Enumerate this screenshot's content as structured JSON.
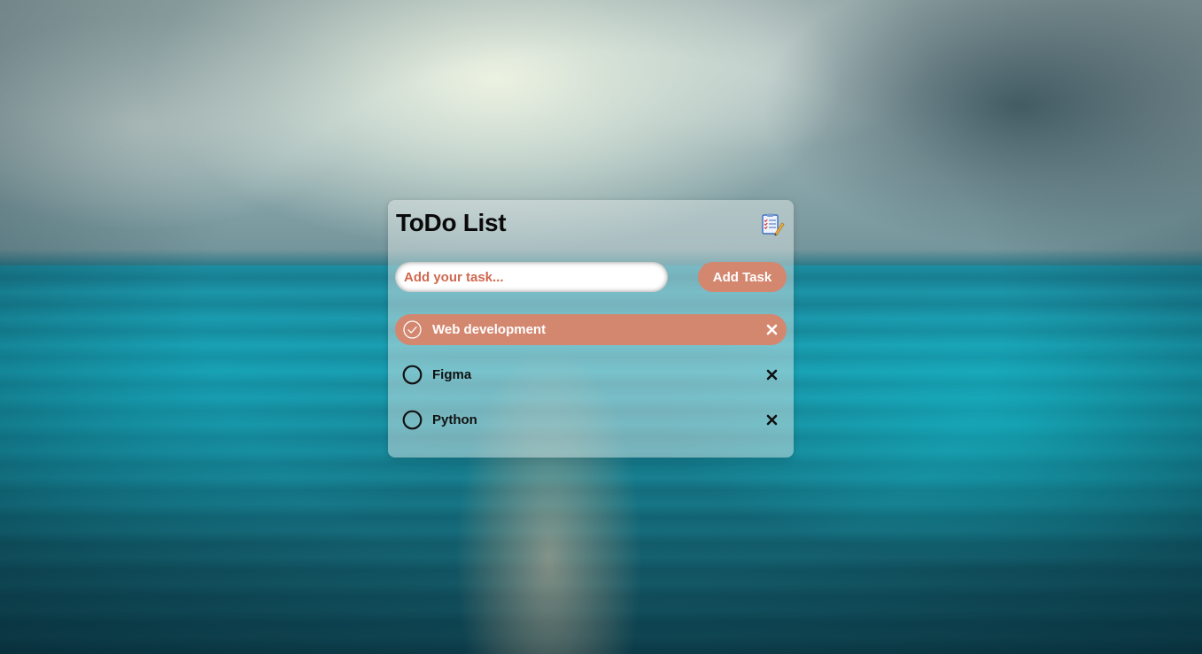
{
  "app": {
    "title": "ToDo List",
    "header_icon": "checklist-notepad-icon"
  },
  "input": {
    "placeholder": "Add your task...",
    "value": ""
  },
  "add_button": {
    "label": "Add Task"
  },
  "tasks": [
    {
      "label": "Web development",
      "completed": true
    },
    {
      "label": "Figma",
      "completed": false
    },
    {
      "label": "Python",
      "completed": false
    }
  ],
  "icons": {
    "checked": "check-circle-icon",
    "unchecked": "empty-circle-icon",
    "delete": "close-x-icon"
  },
  "colors": {
    "accent": "#d4876f",
    "accent_text": "#ffffff",
    "placeholder": "#d0684f",
    "title": "#0a0a0a"
  }
}
